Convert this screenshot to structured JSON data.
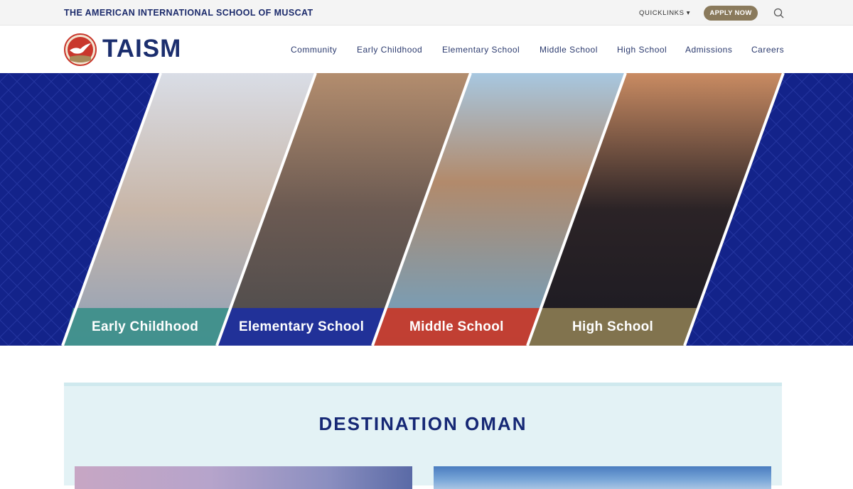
{
  "topbar": {
    "school_name": "THE AMERICAN INTERNATIONAL SCHOOL OF MUSCAT",
    "quicklinks_label": "QUICKLINKS ▾",
    "apply_label": "APPLY NOW"
  },
  "header": {
    "logo_text": "TAISM",
    "nav": [
      "Community",
      "Early Childhood",
      "Elementary School",
      "Middle School",
      "High School",
      "Admissions",
      "Careers"
    ]
  },
  "hero": {
    "panels": [
      {
        "label": "Early Childhood",
        "color": "#3c8f8a"
      },
      {
        "label": "Elementary School",
        "color": "#1f2f9c"
      },
      {
        "label": "Middle School",
        "color": "#c53a2b"
      },
      {
        "label": "High School",
        "color": "#8a7b52"
      }
    ],
    "background_color": "#13238a"
  },
  "destination": {
    "title": "DESTINATION OMAN"
  }
}
